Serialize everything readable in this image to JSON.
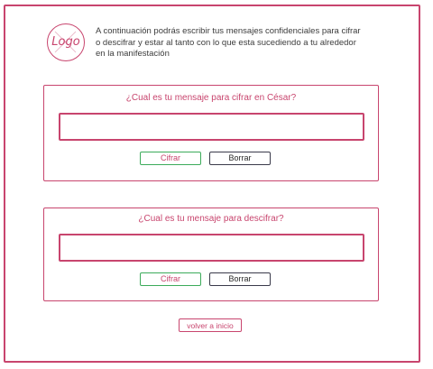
{
  "header": {
    "logo_text": "Logo",
    "intro_text": "A continuación podrás escribir tus mensajes confidenciales para cifrar o descifrar y estar al tanto con lo que esta sucediendo a tu alrededor en la manifestación"
  },
  "encrypt_panel": {
    "title": "¿Cual es tu mensaje para cifrar en César?",
    "input_value": "",
    "cifrar_label": "Cifrar",
    "borrar_label": "Borrar"
  },
  "decrypt_panel": {
    "title": "¿Cual es tu mensaje para descifrar?",
    "input_value": "",
    "cifrar_label": "Cifrar",
    "borrar_label": "Borrar"
  },
  "footer": {
    "back_label": "volver a inicio"
  },
  "colors": {
    "accent": "#c8456e",
    "success": "#3cab5a",
    "dark": "#3a3a4a"
  }
}
